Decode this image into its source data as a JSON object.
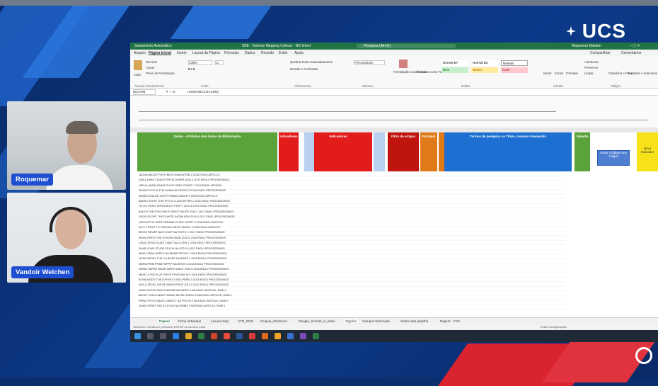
{
  "brand": {
    "logo_text": "UCS"
  },
  "participants": [
    {
      "name": "Roquemar"
    },
    {
      "name": "Vandoir Welchen"
    }
  ],
  "excel": {
    "autosave": "Salvamento Automático",
    "file_title": "SBE - Science Mapping Colocar - NO sheet",
    "search_placeholder": "Pesquisa (Alt+Q)",
    "user": "Roquemar Baldam",
    "tabs": [
      "Arquivo",
      "Página Inicial",
      "Inserir",
      "Layout da Página",
      "Fórmulas",
      "Dados",
      "Revisão",
      "Exibir",
      "Ajuda"
    ],
    "share": "Compartilhar",
    "comments": "Comentários",
    "ribbon": {
      "paste": "Colar",
      "cut": "Recortar",
      "copy": "Copiar",
      "format_painter": "Pincel de Formatação",
      "font_name": "Calibri",
      "font_size": "11",
      "wrap": "Quebrar Texto Automaticamente",
      "merge": "Mesclar e Centralizar",
      "number_format": "Personalizado",
      "conditional": "Formatação Condicional",
      "format_table": "Formatar como Tabela",
      "style_normal_b7": "Normal B7",
      "style_normal_b2": "Normal B2",
      "style_normal": "Normal",
      "style_good": "Bom",
      "style_neutral": "Neutro",
      "style_bad": "Ruim",
      "insert": "Inserir",
      "delete": "Excluir",
      "format": "Formatar",
      "autosum": "AutoSoma",
      "fill": "Preencher",
      "clear": "Limpar",
      "sort": "Classificar e Filtrar",
      "find": "Localizar e Selecionar",
      "groups": [
        "Área de Transferência",
        "Fonte",
        "Alinhamento",
        "Número",
        "Estilos",
        "Células",
        "Edição"
      ]
    },
    "name_box": "BC2498",
    "formula": "=SOMA(BC5:BC2495)",
    "bands": {
      "green": "Dados - Atributos dos dados da Bibliometria",
      "red1": "Indicadores",
      "red2": "Indicadores",
      "filtro": "Filtro de artigos",
      "portugal": "Portugal",
      "blue": "Termos de pesquisa na Título, resumo e keywords",
      "selecao": "Seleção"
    },
    "buttons": {
      "gerar": "Gerar Códigos dos Artigos",
      "novo": "Novo Indicador"
    },
    "rows": [
      "JAGANI BIOSE PHYSI BIOS SIMA NITRIB  2 2018 ENGLI ARTICLE",
      "TAN & DWIGT DIACIT PHYSI DAPRB 2020 4 2020 ENGLI PROCEEDINGS",
      "LEE W, ANTAI AGING PHYSI GEBC COURT 1 2019 ENGLI REVIEW",
      "ZHAN PHYSI IN THE HUMA NA PROCE 0 2018 ENGLI PROCEEDINGS",
      "AHMED DIALDE INSTR PUBMI INSAGR 0 2018 ENGLI ARTICLE",
      "BAERLI ENTRI THIS PHYSI CLASS APTEB 1 2018 ENGLI PROCEEDINGS",
      "HE W HYDRO INTER MULTI PARTY 2013 4 2019 ENGLI PROCEEDINGS",
      "BAETH THE STIN THIS FCERDT RECEP 2018 1 2017 ENGLI PROCEEDINGS",
      "GEOR SCOPE THE PLANTS INTEM NTM 2016 0 2017 ENGLI PROCEEDINGS",
      "LEE DOPTIC SURF PARAME PLANT NTERT 0 2018 ENGLI ARTICLE",
      "DA S CTRUIT TO CIRCOLE WHAT MCKDL 0 2018 ENGLI ARTICLE",
      "BROW REVIEF NAS COMP NA TEXTU 1 2017 ENGLI PROCEEDINGS",
      "MOHA PREDI THE IS BOHN BIOM 2018 6 2018 ENGLI PROCEEDINGS",
      "U BUS DESIG DIADT DIADT NA CURIN 1 2018 ENGLI PROCEEDINGS",
      "ZHAR YOUR STUDE PSYCH NA SZTH 0 2017 ENGLI PROCEEDINGS",
      "MUKU SNAC APPEC NA IBAMP PROCE 1 2018 ENGLI PROCEEDINGS",
      "LIENO DEVEL THE VI HEART NA IEEES 1 2018 ENGLI PROCEEDINGS",
      "MORA PRIM PRIME MPPIF NA REVIE 0 2018 ENGLI PROCEEDINGS",
      "SRINIV IMPRO WEAR IMPRO DAILY 2016 0 2018 ENGLI PROCEEDINGS",
      "MAHO & ROCH VE-PHYSI PHYSI NW W 0 2018 ENGLI PROCEEDINGS",
      "KOWA MODE THE A PHYSI TUNIC PERIE 0 2018 ENGLI PROCEEDINGS",
      "SUN & DEVEL WE DE MANN PRIDE 2013 4 2016 ENGLI PROCEEDINGS",
      "GRAC ECTRO BACH MAVINE NA SIDPC 0 NA ENGLI ARTICLE, EARLY",
      "BECKT CIRCU ADAPT BASIC NEURI SURGY 0 NA ENGLI ARTICLE, EARLY",
      "PRINZ PHYSI OBJEC OBJECT NA PSYCH 0 NA ENGLI ARTICLE, EARLY",
      "LIANG DESIG THE A CLOUD NA MOBIX 0 NA ENGLI ARTICLE, EARLY"
    ],
    "sheets": [
      "Papers",
      "Ficha Individual",
      "Lacuna Gap",
      "JCR_2019",
      "Scopus_CiteScore",
      "Google_Scholar_h_index",
      "Opções",
      "Campos Descrição",
      "Sobre esta planilha",
      "Papers - CSV"
    ],
    "active_sheet": "Papers",
    "status_left": "Selecione o destino e pressione ENTER ou escolha Colar",
    "status_right": "Exibir Configurações",
    "colors": {
      "green": "#5aa23a",
      "red": "#e21b1b",
      "orange": "#e07a18",
      "blue": "#1d6fd1",
      "darkred": "#c0140f"
    }
  }
}
